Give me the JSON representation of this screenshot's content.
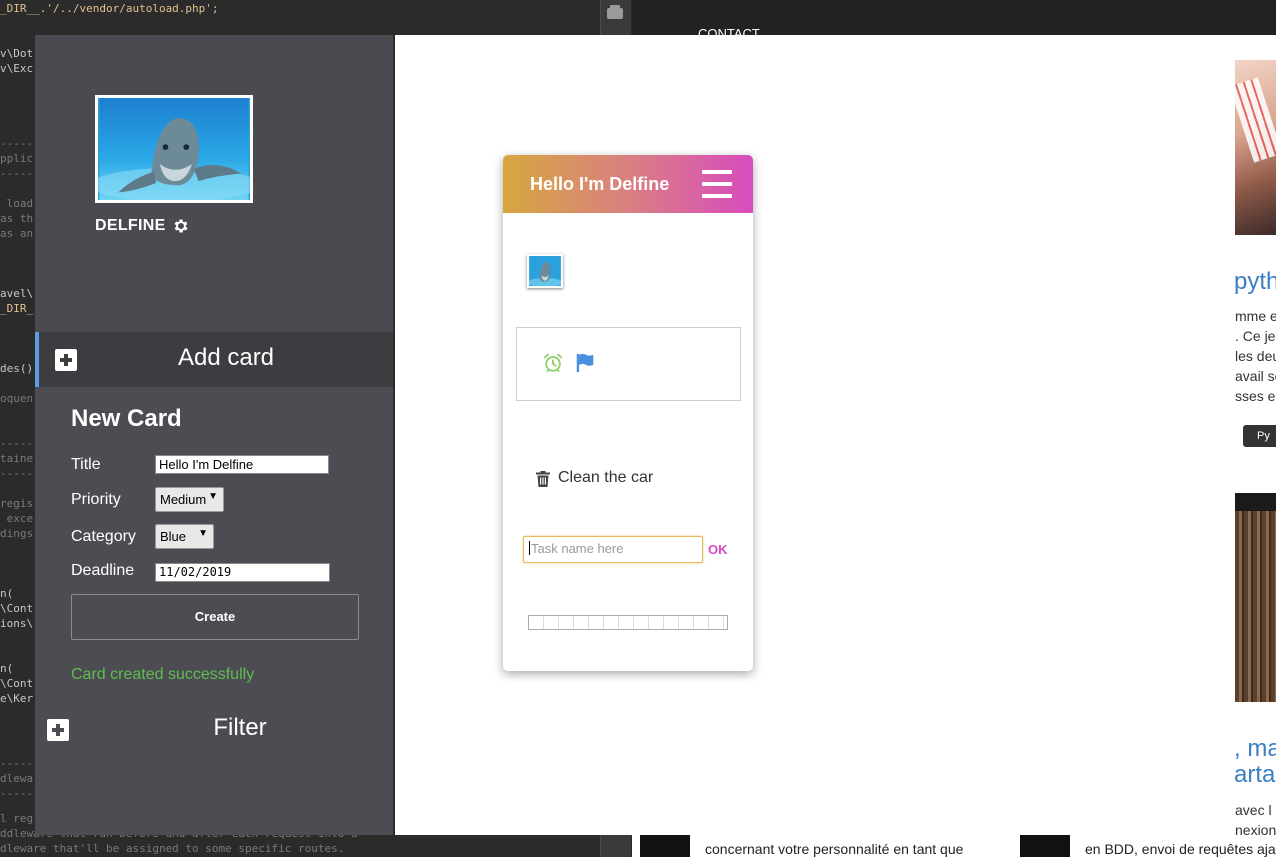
{
  "editor": {
    "lines": [
      {
        "text": "_DIR__.'/../vendor/autoload.php';",
        "kind": "str"
      },
      {
        "text": "v\\Dot",
        "kind": "code"
      },
      {
        "text": "v\\Exc",
        "kind": "code"
      },
      {
        "text": "-----",
        "kind": "cm"
      },
      {
        "text": "pplic",
        "kind": "cm"
      },
      {
        "text": "-----",
        "kind": "cm"
      },
      {
        "text": " load",
        "kind": "cm"
      },
      {
        "text": "as th",
        "kind": "cm"
      },
      {
        "text": "as an",
        "kind": "cm"
      },
      {
        "text": "avel\\",
        "kind": "code"
      },
      {
        "text": "_DIR_",
        "kind": "str"
      },
      {
        "text": "des()",
        "kind": "code"
      },
      {
        "text": "oquen",
        "kind": "cm"
      },
      {
        "text": "-----",
        "kind": "cm"
      },
      {
        "text": "taine",
        "kind": "cm"
      },
      {
        "text": "-----",
        "kind": "cm"
      },
      {
        "text": "regis",
        "kind": "cm"
      },
      {
        "text": " exce",
        "kind": "cm"
      },
      {
        "text": "dings",
        "kind": "cm"
      },
      {
        "text": "n(",
        "kind": "code"
      },
      {
        "text": "\\Cont",
        "kind": "code"
      },
      {
        "text": "ions\\",
        "kind": "code"
      },
      {
        "text": "n(",
        "kind": "code"
      },
      {
        "text": "\\Cont",
        "kind": "code"
      },
      {
        "text": "e\\Ker",
        "kind": "code"
      },
      {
        "text": "-----",
        "kind": "cm"
      },
      {
        "text": "dlewa",
        "kind": "cm"
      },
      {
        "text": "-----",
        "kind": "cm"
      },
      {
        "text": "l reg",
        "kind": "cm"
      },
      {
        "text": "ddleware that run before and after each request into a",
        "kind": "cm"
      },
      {
        "text": "dleware that'll be assigned to some specific routes.",
        "kind": "cm"
      }
    ]
  },
  "site": {
    "nav_link": "CONTACT",
    "heading1": "pyth",
    "text1": [
      "mme et",
      ". Ce je",
      "les deu",
      "avail se",
      "sses en"
    ],
    "tag": "Py",
    "heading2_line1": ", ma",
    "heading2_line2": "arta",
    "text2": [
      "avec l",
      "nexion"
    ],
    "bottom_a": "concernant votre personnalité en tant que",
    "bottom_b": "en BDD, envoi de requêtes aja"
  },
  "sidebar": {
    "profile_name": "DELFINE",
    "settings_icon": "gear-icon",
    "add_card_label": "Add card",
    "filter_label": "Filter"
  },
  "form": {
    "title": "New Card",
    "title_label": "Title",
    "title_value": "Hello I'm Delfine",
    "priority_label": "Priority",
    "priority_value": "Medium",
    "category_label": "Category",
    "category_value": "Blue",
    "deadline_label": "Deadline",
    "deadline_value": "11/02/2019",
    "create_label": "Create",
    "success_message": "Card created successfully"
  },
  "card": {
    "title": "Hello I'm Delfine",
    "menu_icon": "hamburger-menu-icon",
    "meta_icons": [
      "alarm-clock-icon",
      "flag-icon"
    ],
    "tasks": [
      {
        "label": "Clean the car"
      }
    ],
    "task_placeholder": "Task name here",
    "ok_label": "OK",
    "progress": 0
  },
  "colors": {
    "header_gradient_start": "#d6a740",
    "header_gradient_end": "#d84bbf",
    "accent_pink": "#d84bbf",
    "success_green": "#5cbf4d",
    "active_border": "#5b9be0",
    "alarm_green": "#8fd16b",
    "flag_blue": "#4a90e2"
  }
}
